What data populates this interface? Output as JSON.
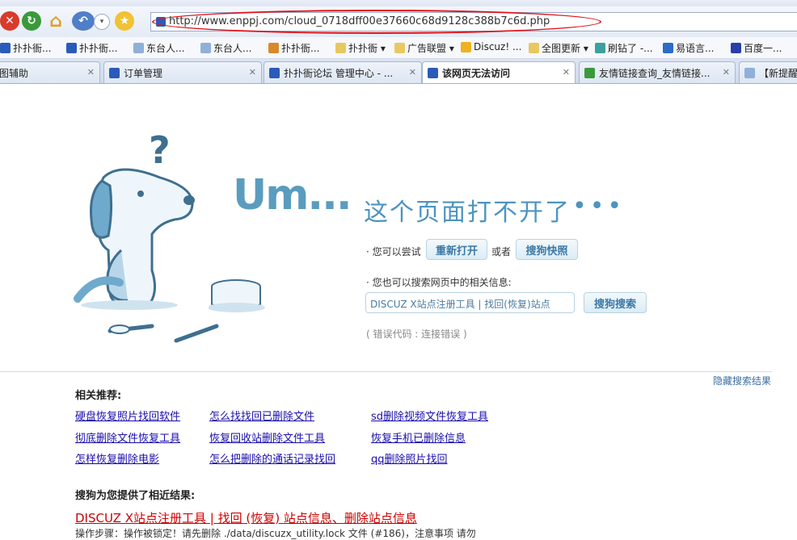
{
  "browser": {
    "address": "http://www.enppj.com/cloud_0718dff00e37660c68d9128c388b7c6d.php",
    "toolbar_icons": [
      "stop-icon",
      "refresh-icon",
      "home-icon",
      "back-icon",
      "favorites-star-icon"
    ]
  },
  "bookmarks": [
    {
      "label": "扑扑衙...",
      "icon": "ie-page-icon"
    },
    {
      "label": "扑扑衙...",
      "icon": "ie-page-icon"
    },
    {
      "label": "东台人...",
      "icon": "df-icon"
    },
    {
      "label": "东台人...",
      "icon": "df-icon"
    },
    {
      "label": "扑扑衙...",
      "icon": "colorful-icon"
    },
    {
      "label": "扑扑衙 ▾",
      "icon": "folder-icon"
    },
    {
      "label": "广告联盟 ▾",
      "icon": "folder-icon"
    },
    {
      "label": "Discuz! ...",
      "icon": "trophy-icon"
    },
    {
      "label": "全图更新 ▾",
      "icon": "folder-icon"
    },
    {
      "label": "刷钻了 -...",
      "icon": "diamond-icon"
    },
    {
      "label": "易语言...",
      "icon": "yi-icon"
    },
    {
      "label": "百度一...",
      "icon": "baidu-paw-icon"
    }
  ],
  "tabs": [
    {
      "label": "图辅助",
      "active": false
    },
    {
      "label": "订单管理",
      "active": false
    },
    {
      "label": "扑扑衙论坛 管理中心 - ...",
      "active": false
    },
    {
      "label": "该网页无法访问",
      "active": true
    },
    {
      "label": "友情链接查询_友情链接...",
      "active": false
    },
    {
      "label": "【新提醒",
      "active": false
    }
  ],
  "error_page": {
    "um": "Um...",
    "headline": "这个页面打不开了",
    "dots": "•••",
    "try_text": "· 您可以尝试",
    "reopen_button": "重新打开",
    "or_text": "或者",
    "snapshot_button": "搜狗快照",
    "search_hint": "· 您也可以搜索网页中的相关信息:",
    "search_value": "DISCUZ X站点注册工具 | 找回(恢复)站点",
    "search_button": "搜狗搜索",
    "error_code": "( 错误代码 : 连接错误 )"
  },
  "results": {
    "hide_label": "隐藏搜索结果",
    "recommend_title": "相关推荐:",
    "recommend_links": [
      "硬盘恢复照片找回软件",
      "怎么找找回已删除文件",
      "sd删除视频文件恢复工具",
      "彻底删除文件恢复工具",
      "恢复回收站删除文件工具",
      "恢复手机已删除信息",
      "怎样恢复删除电影",
      "怎么把删除的通话记录找回",
      "qq删除照片找回"
    ],
    "near_title": "搜狗为您提供了相近结果:",
    "result_title": "DISCUZ X站点注册工具 | 找回 (恢复) 站点信息、删除站点信息",
    "result_snippet": "操作步骤：操作被锁定！请先删除 ./data/discuzx_utility.lock 文件 (#186)，注意事项 请勿"
  },
  "colors": {
    "accent_blue": "#5a9cbf",
    "link": "#1a0dab",
    "result_red": "#c00",
    "annotation_red": "#e0141b"
  }
}
